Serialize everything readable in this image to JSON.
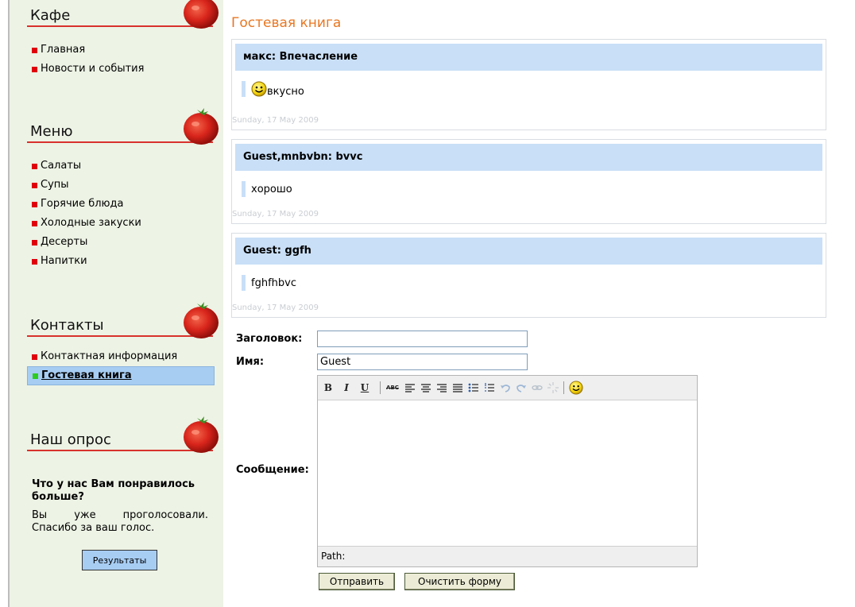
{
  "sidebar": {
    "sections": [
      {
        "title": "Кафе",
        "items": [
          {
            "label": "Главная"
          },
          {
            "label": "Новости и события"
          }
        ]
      },
      {
        "title": "Меню",
        "items": [
          {
            "label": "Салаты"
          },
          {
            "label": "Супы"
          },
          {
            "label": "Горячие блюда"
          },
          {
            "label": "Холодные закуски"
          },
          {
            "label": "Десерты"
          },
          {
            "label": "Напитки"
          }
        ]
      },
      {
        "title": "Контакты",
        "items": [
          {
            "label": "Контактная информация"
          },
          {
            "label": "Гостевая книга",
            "active": true
          }
        ]
      },
      {
        "title": "Наш опрос"
      }
    ],
    "poll": {
      "question": "Что у нас Вам понравилось больше?",
      "note": "Вы уже проголосовали. Спасибо за ваш голос.",
      "results_button": "Результаты"
    }
  },
  "main": {
    "title": "Гостевая книга",
    "entries": [
      {
        "header": "макс: Впечасление",
        "message": "вкусно",
        "has_smiley": true,
        "date": "Sunday, 17 May 2009"
      },
      {
        "header": "Guest,mnbvbn: bvvc",
        "message": "хорошо",
        "has_smiley": false,
        "date": "Sunday, 17 May 2009"
      },
      {
        "header": "Guest: ggfh",
        "message": "fghfhbvc",
        "has_smiley": false,
        "date": "Sunday, 17 May 2009"
      }
    ],
    "form": {
      "subject_label": "Заголовок:",
      "subject_value": "",
      "name_label": "Имя:",
      "name_value": "Guest",
      "message_label": "Сообщение:",
      "toolbar": {
        "bold": "B",
        "italic": "I",
        "underline": "U",
        "strikethrough": "ABC"
      },
      "path_label": "Path:",
      "submit_button": "Отправить",
      "clear_button": "Очистить форму"
    }
  },
  "colors": {
    "sidebar_bg": "#edf3e5",
    "accent_red": "#e0000d",
    "heading_line": "#d8312c",
    "title_orange": "#e87722",
    "entry_header_bg": "#c9dff7",
    "active_item_bg": "#a7cdf3",
    "active_bullet": "#2ecc1e"
  }
}
